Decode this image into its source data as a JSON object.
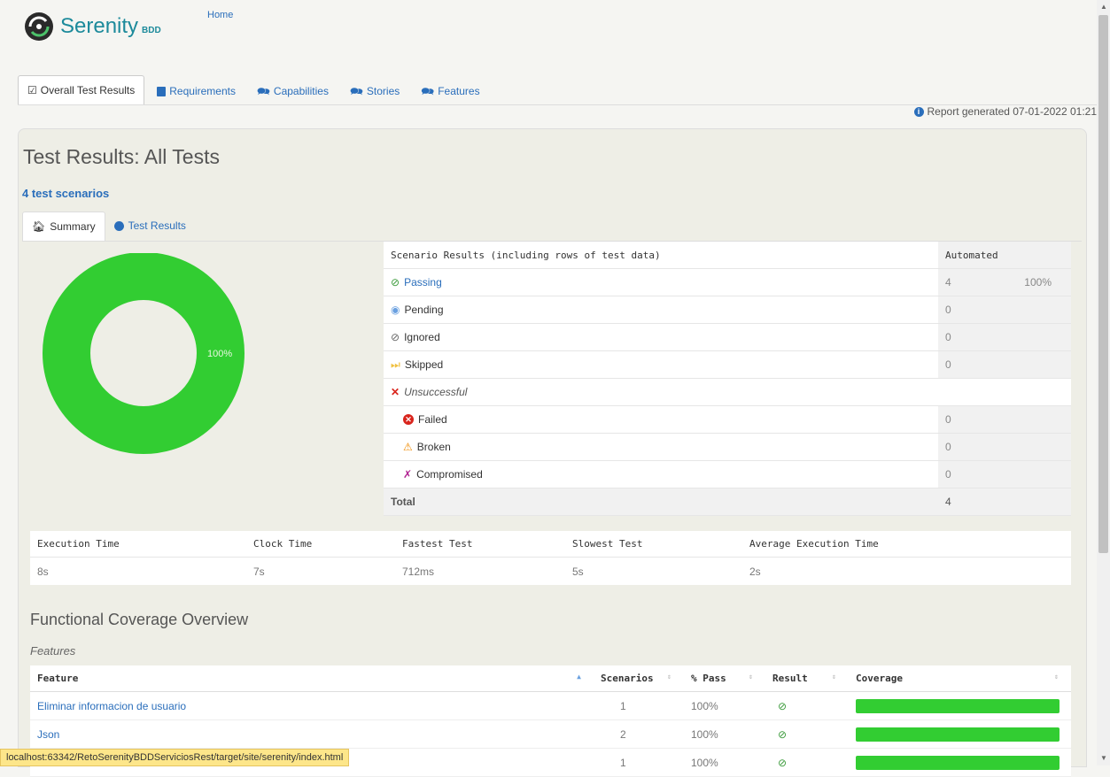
{
  "header": {
    "logo_text": "Serenity",
    "logo_sub": "BDD",
    "home_link": "Home"
  },
  "main_tabs": [
    {
      "label": "Overall Test Results",
      "icon": "check-square-icon"
    },
    {
      "label": "Requirements",
      "icon": "book-icon"
    },
    {
      "label": "Capabilities",
      "icon": "comments-icon"
    },
    {
      "label": "Stories",
      "icon": "comments-icon"
    },
    {
      "label": "Features",
      "icon": "comments-icon"
    }
  ],
  "report_generated": "Report generated 07-01-2022 01:21",
  "page": {
    "title": "Test Results: All Tests",
    "scenario_count": "4 test scenarios"
  },
  "sub_tabs": [
    {
      "label": "Summary",
      "icon": "home-icon"
    },
    {
      "label": "Test Results",
      "icon": "dashboard-icon"
    }
  ],
  "donut": {
    "label": "100%",
    "pass_fraction": 1.0,
    "color": "#32cd32"
  },
  "results": {
    "header": "Scenario Results (including rows of test data)",
    "automated_header": "Automated",
    "rows": [
      {
        "label": "Passing",
        "count": "4",
        "pct": "100%",
        "color": "#2a6ebb"
      },
      {
        "label": "Pending",
        "count": "0"
      },
      {
        "label": "Ignored",
        "count": "0"
      },
      {
        "label": "Skipped",
        "count": "0"
      },
      {
        "label": "Unsuccessful"
      },
      {
        "label": "Failed",
        "count": "0"
      },
      {
        "label": "Broken",
        "count": "0"
      },
      {
        "label": "Compromised",
        "count": "0"
      }
    ],
    "total_label": "Total",
    "total_count": "4"
  },
  "execution": {
    "headers": [
      "Execution Time",
      "Clock Time",
      "Fastest Test",
      "Slowest Test",
      "Average Execution Time"
    ],
    "values": [
      "8s",
      "7s",
      "712ms",
      "5s",
      "2s"
    ]
  },
  "coverage": {
    "title": "Functional Coverage Overview",
    "features_label": "Features",
    "headers": [
      "Feature",
      "Scenarios",
      "% Pass",
      "Result",
      "Coverage"
    ],
    "rows": [
      {
        "feature": "Eliminar informacion de usuario",
        "scenarios": "1",
        "pass": "100%",
        "coverage": 1.0
      },
      {
        "feature": "Json",
        "scenarios": "2",
        "pass": "100%",
        "coverage": 1.0
      },
      {
        "feature": "",
        "scenarios": "1",
        "pass": "100%",
        "coverage": 1.0
      }
    ]
  },
  "status_url": "localhost:63342/RetoSerenityBDDServiciosRest/target/site/serenity/index.html"
}
